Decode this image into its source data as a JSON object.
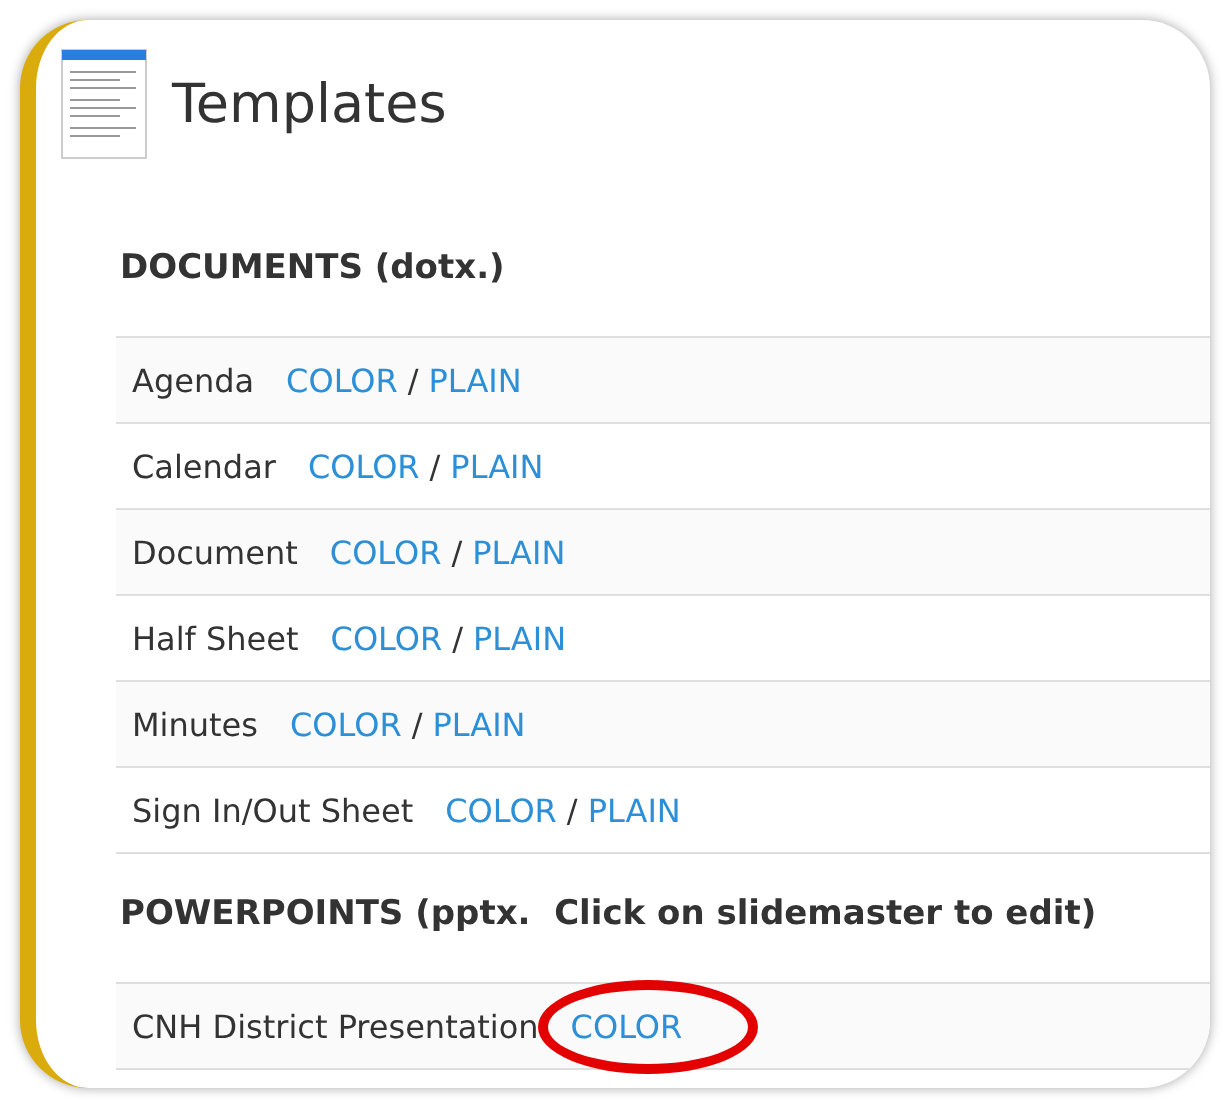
{
  "page": {
    "title": "Templates"
  },
  "sections": [
    {
      "heading": "DOCUMENTS (dotx.)",
      "rows": [
        {
          "name": "Agenda",
          "items": [
            {
              "kind": "link",
              "text": "COLOR",
              "circled": false
            },
            {
              "kind": "text",
              "text": "/"
            },
            {
              "kind": "link",
              "text": "PLAIN",
              "circled": false
            }
          ]
        },
        {
          "name": "Calendar",
          "items": [
            {
              "kind": "link",
              "text": "COLOR",
              "circled": false
            },
            {
              "kind": "text",
              "text": "/"
            },
            {
              "kind": "link",
              "text": "PLAIN",
              "circled": false
            }
          ]
        },
        {
          "name": "Document",
          "items": [
            {
              "kind": "link",
              "text": "COLOR",
              "circled": false
            },
            {
              "kind": "text",
              "text": "/"
            },
            {
              "kind": "link",
              "text": "PLAIN",
              "circled": false
            }
          ]
        },
        {
          "name": "Half Sheet",
          "items": [
            {
              "kind": "link",
              "text": "COLOR",
              "circled": false
            },
            {
              "kind": "text",
              "text": "/"
            },
            {
              "kind": "link",
              "text": "PLAIN",
              "circled": false
            }
          ]
        },
        {
          "name": "Minutes",
          "items": [
            {
              "kind": "link",
              "text": "COLOR",
              "circled": false
            },
            {
              "kind": "text",
              "text": "/"
            },
            {
              "kind": "link",
              "text": "PLAIN",
              "circled": false
            }
          ]
        },
        {
          "name": "Sign In/Out Sheet",
          "items": [
            {
              "kind": "link",
              "text": "COLOR",
              "circled": false
            },
            {
              "kind": "text",
              "text": "/"
            },
            {
              "kind": "link",
              "text": "PLAIN",
              "circled": false
            }
          ]
        }
      ]
    },
    {
      "heading": "POWERPOINTS (pptx.  Click on slidemaster to edit)",
      "rows": [
        {
          "name": "CNH District Presentation",
          "items": [
            {
              "kind": "link",
              "text": "COLOR",
              "circled": true
            }
          ]
        }
      ]
    }
  ]
}
